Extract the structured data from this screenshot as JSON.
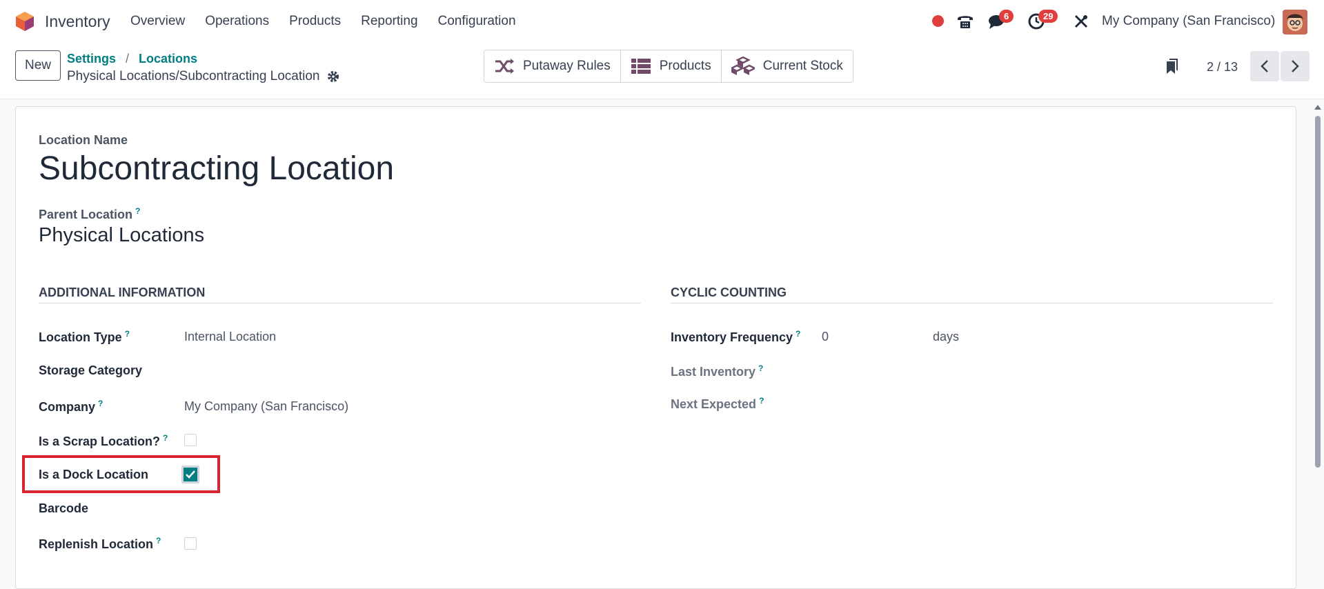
{
  "navbar": {
    "app_name": "Inventory",
    "menu": [
      "Overview",
      "Operations",
      "Products",
      "Reporting",
      "Configuration"
    ],
    "messages_badge": "6",
    "activities_badge": "29",
    "company": "My Company (San Francisco)",
    "icons": [
      "app-logo-icon",
      "record-icon",
      "phone-icon",
      "chat-icon",
      "clock-icon",
      "tools-icon"
    ]
  },
  "control": {
    "new_label": "New",
    "breadcrumb": [
      "Settings",
      "Locations"
    ],
    "record_title": "Physical Locations/Subcontracting Location",
    "smart_buttons": [
      "Putaway Rules",
      "Products",
      "Current Stock"
    ],
    "pager": "2 / 13"
  },
  "form": {
    "name_label": "Location Name",
    "name": "Subcontracting Location",
    "parent_label": "Parent Location",
    "parent": "Physical Locations",
    "help_mark": "?",
    "additional": {
      "heading": "Additional Information",
      "location_type_label": "Location Type",
      "location_type": "Internal Location",
      "storage_category_label": "Storage Category",
      "company_label": "Company",
      "company": "My Company (San Francisco)",
      "scrap_label": "Is a Scrap Location?",
      "scrap": false,
      "dock_label": "Is a Dock Location",
      "dock": true,
      "barcode_label": "Barcode",
      "replenish_label": "Replenish Location",
      "replenish": false
    },
    "cyclic": {
      "heading": "Cyclic Counting",
      "frequency_label": "Inventory Frequency",
      "frequency": "0",
      "frequency_unit": "days",
      "last_label": "Last Inventory",
      "next_label": "Next Expected"
    }
  },
  "colors": {
    "accent": "#017e84",
    "badge": "#e03e3e",
    "highlight": "#d9232e",
    "brand": "#714b67"
  }
}
